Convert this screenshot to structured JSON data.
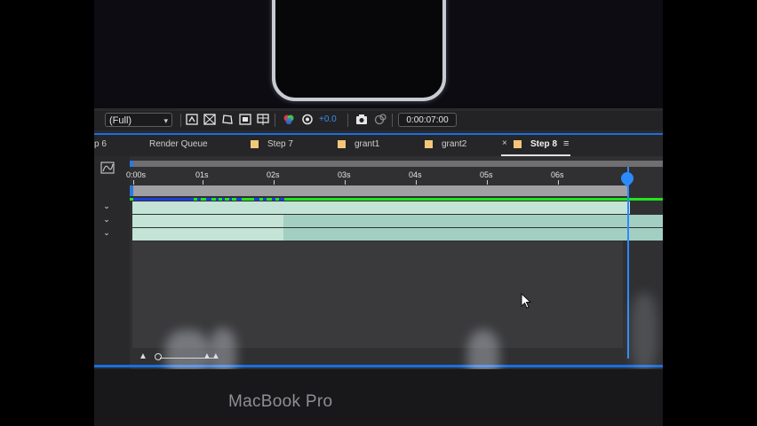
{
  "toolbar": {
    "resolution": "(Full)",
    "exposure": "+0.0",
    "timecode": "0:00:07:00"
  },
  "tabs": [
    {
      "label": "p 6"
    },
    {
      "label": "Render Queue"
    },
    {
      "label": "Step 7"
    },
    {
      "label": "grant1"
    },
    {
      "label": "grant2"
    },
    {
      "label": "Step 8",
      "active": true
    }
  ],
  "close_glyph": "×",
  "menu_glyph": "≡",
  "ruler": {
    "labels": [
      "0:00s",
      "01s",
      "02s",
      "03s",
      "04s",
      "05s",
      "06s"
    ]
  },
  "bezel": {
    "label": "MacBook Pro"
  },
  "colors": {
    "accent": "#1a6fe0",
    "track_green": "#1ee61e",
    "tab_square": "#f3c77a",
    "layer_bar": "#c3e4d6"
  },
  "icons": [
    "graph-editor-icon",
    "color-channel-icon",
    "exposure-icon",
    "snapshot-icon",
    "show-snapshot-icon",
    "zoom-out-icon",
    "zoom-in-icon",
    "mouse-cursor-icon"
  ]
}
